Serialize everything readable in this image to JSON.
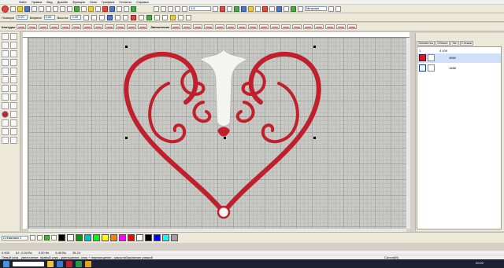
{
  "menubar": {
    "items": [
      "Файл",
      "Правка",
      "Вид",
      "Дизайн",
      "Функции",
      "Окно",
      "Графика",
      "Утилиты",
      "Справка"
    ]
  },
  "toolbar1": {
    "zoom_value": "1:6",
    "units_value": "Метрика"
  },
  "toolbar2": {
    "fields": [
      {
        "label": "Позиция",
        "value": "0.00"
      },
      {
        "label": "Ширина",
        "value": "0.00"
      },
      {
        "label": "Высота",
        "value": "0.00"
      }
    ]
  },
  "toolbar3": {
    "contours_label": "Контуры",
    "fill_label": "Заполнение"
  },
  "right_panel": {
    "tabs": [
      "Элементы",
      "Объект",
      "Тип",
      "Стежки"
    ],
    "rows": [
      {
        "num": "1",
        "color": "#c02030",
        "count": "4 109"
      },
      {
        "num": "2",
        "color": "#c02030",
        "count": "4560"
      },
      {
        "num": "3",
        "color": "#f4f4f4",
        "count": "1688"
      }
    ]
  },
  "colorbar": {
    "dropdown_value": "Стежковка 1",
    "colors": [
      "#000000",
      "#ffffff",
      "#00a000",
      "#00c0c0",
      "#00ff00",
      "#ffff00",
      "#ff8000",
      "#ff00ff",
      "#ff0000",
      "#ffffff",
      "#000000",
      "#0000ff",
      "#00ffff",
      "#a0a0a0"
    ]
  },
  "status": {
    "line1": [
      "0.000",
      "Ш: -0.04 Вс",
      "0.00 Кл",
      "6.40 Вс",
      "35.24"
    ],
    "line2": "Левый клик - увеличение, правый клик - уменьшение, клик + перемещение - масштабирование рамкой",
    "right": "Салон(M)"
  },
  "taskbar": {
    "clock": "20:02"
  },
  "icons": {
    "app_logo": "rose-logo-icon",
    "design_motif": "heart-embroidery"
  }
}
